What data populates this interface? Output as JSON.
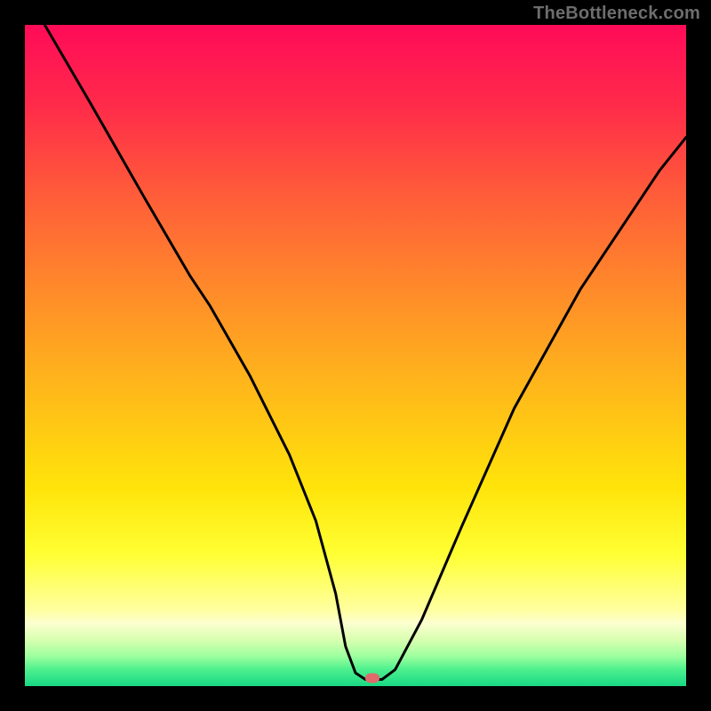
{
  "watermark_text": "TheBottleneck.com",
  "chart_data": {
    "type": "line",
    "title": "",
    "xlabel": "",
    "ylabel": "",
    "xlim": [
      0,
      100
    ],
    "ylim": [
      0,
      100
    ],
    "grid": false,
    "legend": false,
    "gradient_stops": [
      {
        "pos": 0.0,
        "color": "#ff0b58"
      },
      {
        "pos": 0.12,
        "color": "#ff2a4a"
      },
      {
        "pos": 0.25,
        "color": "#ff5a3a"
      },
      {
        "pos": 0.4,
        "color": "#ff8a2a"
      },
      {
        "pos": 0.55,
        "color": "#ffb81a"
      },
      {
        "pos": 0.7,
        "color": "#ffe40a"
      },
      {
        "pos": 0.8,
        "color": "#ffff33"
      },
      {
        "pos": 0.885,
        "color": "#ffffa0"
      },
      {
        "pos": 0.905,
        "color": "#fcffd0"
      },
      {
        "pos": 0.93,
        "color": "#d8ffb0"
      },
      {
        "pos": 0.955,
        "color": "#9dff9e"
      },
      {
        "pos": 0.975,
        "color": "#4df08e"
      },
      {
        "pos": 1.0,
        "color": "#18d884"
      }
    ],
    "series": [
      {
        "name": "bottleneck-curve",
        "color": "#000000",
        "width": 3,
        "x": [
          3,
          10,
          18,
          25,
          28,
          34,
          40,
          44,
          47,
          48.5,
          50,
          51.5,
          54,
          56,
          60,
          66,
          74,
          84,
          96,
          100
        ],
        "y": [
          100,
          88,
          74,
          62,
          57.5,
          47,
          35,
          25,
          14,
          6,
          2,
          1,
          1,
          2.5,
          10,
          24,
          42,
          60,
          78,
          83
        ]
      }
    ],
    "marker": {
      "x": 52.5,
      "y": 1.2,
      "color": "#e06a6b"
    }
  }
}
